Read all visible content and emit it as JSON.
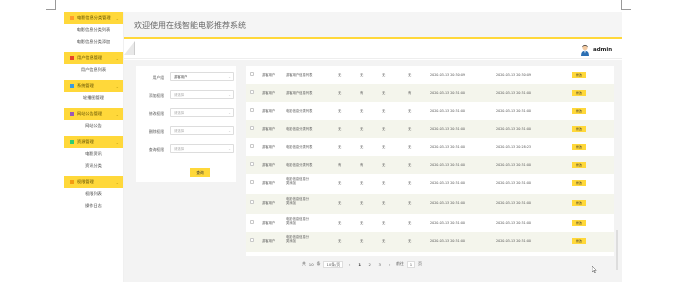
{
  "header": {
    "title": "欢迎使用在线智能电影推荐系统",
    "username": "admin"
  },
  "sidebar": {
    "items": [
      {
        "type": "group",
        "label": "电影信息分类管理"
      },
      {
        "type": "sub",
        "label": "电影信息分类列表"
      },
      {
        "type": "sub",
        "label": "电影信息分类添加"
      },
      {
        "type": "group",
        "label": "用户信息管理"
      },
      {
        "type": "sub",
        "label": "用户信息列表"
      },
      {
        "type": "group",
        "label": "系统管理"
      },
      {
        "type": "sub",
        "label": "轮播图管理"
      },
      {
        "type": "group",
        "label": "网站公告管理"
      },
      {
        "type": "sub",
        "label": "网站公告"
      },
      {
        "type": "group",
        "label": "资源管理"
      },
      {
        "type": "sub",
        "label": "电影资讯"
      },
      {
        "type": "sub",
        "label": "资讯分类"
      },
      {
        "type": "group",
        "label": "权限管理"
      },
      {
        "type": "sub",
        "label": "权限列表"
      },
      {
        "type": "sub",
        "label": "操作日志"
      }
    ]
  },
  "filter": {
    "fields": [
      {
        "label": "用户组",
        "value": "游客用户",
        "placeholder": ""
      },
      {
        "label": "添加权限",
        "value": "",
        "placeholder": "请选择"
      },
      {
        "label": "修改权限",
        "value": "",
        "placeholder": "请选择"
      },
      {
        "label": "删除权限",
        "value": "",
        "placeholder": "请选择"
      },
      {
        "label": "查询权限",
        "value": "",
        "placeholder": "请选择"
      }
    ],
    "query_label": "查询"
  },
  "table": {
    "edit_label": "修改",
    "rows": [
      {
        "group": "游客用户",
        "name": "游客用户信息列表",
        "a": "无",
        "b": "无",
        "c": "无",
        "d": "无",
        "created": "2020-03-13 20:30:09",
        "updated": "2020-03-13 20:30:09"
      },
      {
        "group": "游客用户",
        "name": "游客用户信息列表",
        "a": "无",
        "b": "有",
        "c": "无",
        "d": "有",
        "created": "2020-03-13 20:31:00",
        "updated": "2020-03-13 20:31:00"
      },
      {
        "group": "游客用户",
        "name": "电影信息分类列表",
        "a": "无",
        "b": "无",
        "c": "无",
        "d": "无",
        "created": "2020-03-13 20:31:00",
        "updated": "2020-03-13 20:31:00"
      },
      {
        "group": "游客用户",
        "name": "电影信息分类列表",
        "a": "无",
        "b": "无",
        "c": "无",
        "d": "无",
        "created": "2020-03-13 20:31:00",
        "updated": "2020-03-13 20:31:00"
      },
      {
        "group": "游客用户",
        "name": "电影信息分类列表",
        "a": "无",
        "b": "无",
        "c": "无",
        "d": "无",
        "created": "2020-03-13 20:31:00",
        "updated": "2020-03-13 20:28:23"
      },
      {
        "group": "游客用户",
        "name": "电影信息分类列表",
        "a": "有",
        "b": "有",
        "c": "无",
        "d": "无",
        "created": "2020-03-13 20:31:00",
        "updated": "2020-03-13 20:31:00"
      },
      {
        "group": "游客用户",
        "name": "电影信息信息分类添加",
        "a": "无",
        "b": "无",
        "c": "无",
        "d": "无",
        "created": "2020-03-13 20:31:00",
        "updated": "2020-03-13 20:31:00"
      },
      {
        "group": "游客用户",
        "name": "电影信息信息分类添加",
        "a": "无",
        "b": "无",
        "c": "无",
        "d": "无",
        "created": "2020-03-13 20:31:00",
        "updated": "2020-03-13 20:31:00"
      },
      {
        "group": "游客用户",
        "name": "电影信息信息分类添加",
        "a": "无",
        "b": "无",
        "c": "无",
        "d": "无",
        "created": "2020-03-13 20:31:00",
        "updated": "2020-03-13 20:31:00"
      },
      {
        "group": "游客用户",
        "name": "电影信息信息分类添加",
        "a": "无",
        "b": "无",
        "c": "无",
        "d": "无",
        "created": "2020-03-13 20:31:00",
        "updated": "2020-03-13 20:31:00"
      }
    ]
  },
  "pager": {
    "total_prefix": "共",
    "total_count": "10",
    "total_suffix": "条",
    "page_size": "10条/页",
    "prev": "‹",
    "pages": [
      "1",
      "2",
      "3"
    ],
    "next": "›",
    "goto_prefix": "前往",
    "goto_value": "1",
    "goto_suffix": "页"
  },
  "colors": {
    "accent": "#ffd83a",
    "alt_row": "#f4f5ec"
  }
}
